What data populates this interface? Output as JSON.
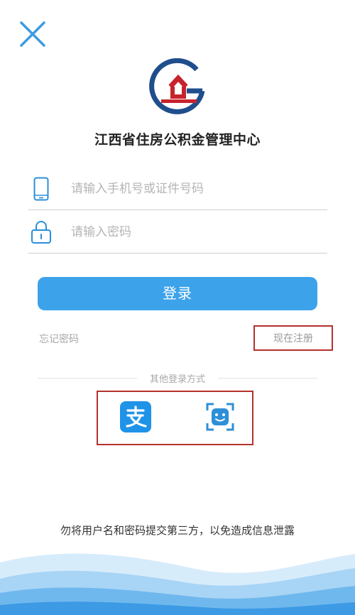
{
  "org": {
    "title": "江西省住房公积金管理中心"
  },
  "form": {
    "phone_placeholder": "请输入手机号或证件号码",
    "password_placeholder": "请输入密码",
    "login_label": "登录",
    "forgot_label": "忘记密码",
    "register_label": "现在注册"
  },
  "other_login": {
    "label": "其他登录方式",
    "methods": [
      {
        "icon": "alipay-icon"
      },
      {
        "icon": "face-recognition-icon"
      }
    ]
  },
  "notice": "勿将用户名和密码提交第三方，以免造成信息泄露",
  "icons": {
    "close": "close-icon",
    "phone": "phone-icon",
    "lock": "lock-icon",
    "logo": "housing-fund-logo"
  },
  "colors": {
    "accent": "#3ca2ea",
    "highlight_border": "#b5312c",
    "logo_blue": "#1f4e8c",
    "logo_red": "#c8232c"
  }
}
